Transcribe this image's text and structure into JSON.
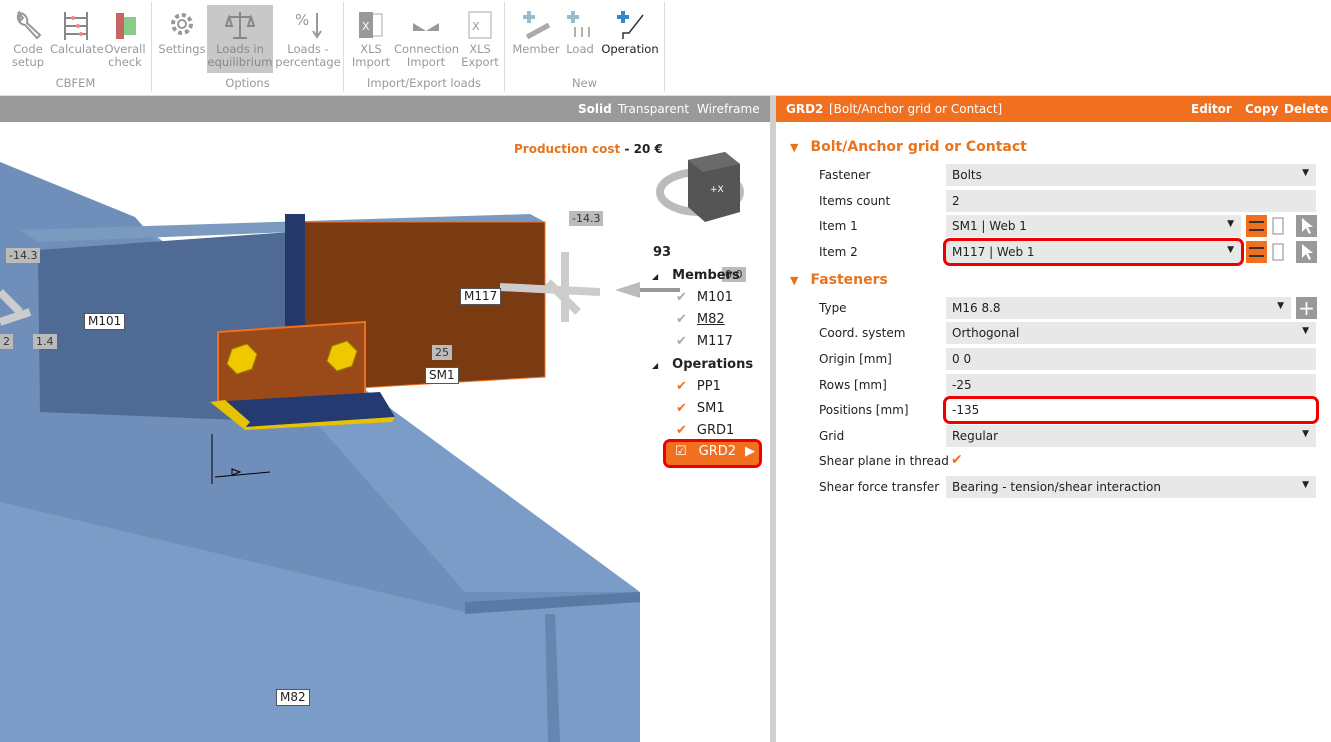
{
  "toolbar": {
    "groups": [
      {
        "title": "CBFEM"
      },
      {
        "title": "Options"
      },
      {
        "title": "Import/Export loads"
      },
      {
        "title": "New"
      }
    ],
    "buttons": {
      "code_setup": [
        "Code",
        "setup"
      ],
      "calculate": "Calculate",
      "overall_check": [
        "Overall",
        "check"
      ],
      "settings": "Settings",
      "loads_eq": [
        "Loads in",
        "equilibrium"
      ],
      "loads_pct": [
        "Loads -",
        "percentage"
      ],
      "xls_import": [
        "XLS",
        "Import"
      ],
      "conn_import": [
        "Connection",
        "Import"
      ],
      "xls_export": [
        "XLS",
        "Export"
      ],
      "member": "Member",
      "load": "Load",
      "operation": "Operation"
    }
  },
  "viewbar": {
    "solid": "Solid",
    "transparent": "Transparent",
    "wireframe": "Wireframe"
  },
  "viewport": {
    "cost_label": "Production cost",
    "cost_sep": "-",
    "cost_value": "20 €",
    "cube_label": "+X",
    "labels": {
      "m101": "M101",
      "m117": "M117",
      "m82": "M82",
      "sm1": "SM1"
    },
    "dims": {
      "d1": "-14.3",
      "d2": "-14.3",
      "d3": "1.4",
      "d4": "25",
      "d5": "2",
      "d6": "0.0"
    },
    "tree": {
      "count": "93",
      "members": "Members",
      "members_items": [
        "M101",
        "M82",
        "M117"
      ],
      "operations": "Operations",
      "operations_items": [
        "PP1",
        "SM1",
        "GRD1",
        "GRD2"
      ]
    }
  },
  "panel": {
    "header": {
      "name": "GRD2",
      "type": "[Bolt/Anchor grid or Contact]",
      "editor": "Editor",
      "copy": "Copy",
      "delete": "Delete"
    },
    "section1": "Bolt/Anchor grid or Contact",
    "section2": "Fasteners",
    "rows1": [
      {
        "label": "Fastener",
        "value": "Bolts"
      },
      {
        "label": "Items count",
        "value": "2"
      },
      {
        "label": "Item 1",
        "value": "SM1 | Web 1"
      },
      {
        "label": "Item 2",
        "value": "M117 | Web 1"
      }
    ],
    "rows2": [
      {
        "label": "Type",
        "value": "M16 8.8"
      },
      {
        "label": "Coord. system",
        "value": "Orthogonal"
      },
      {
        "label": "Origin [mm]",
        "value": "0 0"
      },
      {
        "label": "Rows [mm]",
        "value": "-25"
      },
      {
        "label": "Positions [mm]",
        "value": "-135"
      },
      {
        "label": "Grid",
        "value": "Regular"
      },
      {
        "label": "Shear plane in thread",
        "value": ""
      },
      {
        "label": "Shear force transfer",
        "value": "Bearing - tension/shear interaction"
      }
    ]
  },
  "colors": {
    "accent": "#f07020",
    "highlight": "#e00000"
  }
}
